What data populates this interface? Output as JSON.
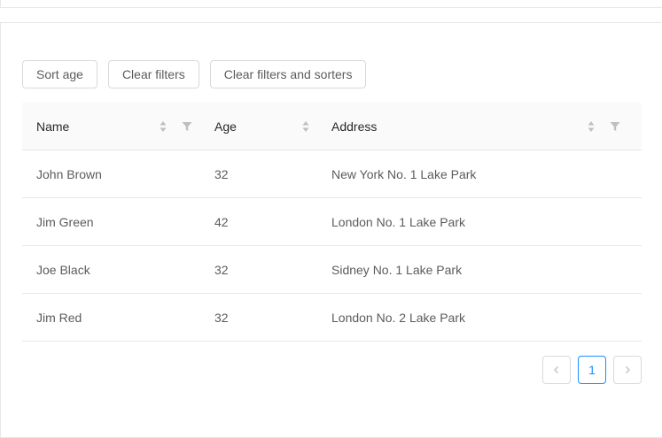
{
  "toolbar": {
    "sort_age": "Sort age",
    "clear_filters": "Clear filters",
    "clear_filters_and_sorters": "Clear filters and sorters"
  },
  "table": {
    "columns": [
      {
        "label": "Name",
        "sortable": true,
        "filterable": true
      },
      {
        "label": "Age",
        "sortable": true,
        "filterable": false
      },
      {
        "label": "Address",
        "sortable": true,
        "filterable": true
      }
    ],
    "rows": [
      {
        "name": "John Brown",
        "age": "32",
        "address": "New York No. 1 Lake Park"
      },
      {
        "name": "Jim Green",
        "age": "42",
        "address": "London No. 1 Lake Park"
      },
      {
        "name": "Joe Black",
        "age": "32",
        "address": "Sidney No. 1 Lake Park"
      },
      {
        "name": "Jim Red",
        "age": "32",
        "address": "London No. 2 Lake Park"
      }
    ]
  },
  "pagination": {
    "current_page": "1"
  },
  "colors": {
    "accent": "#1890ff",
    "border": "#e8e8e8",
    "header_bg": "#fafafa",
    "icon": "#bfbfbf"
  }
}
